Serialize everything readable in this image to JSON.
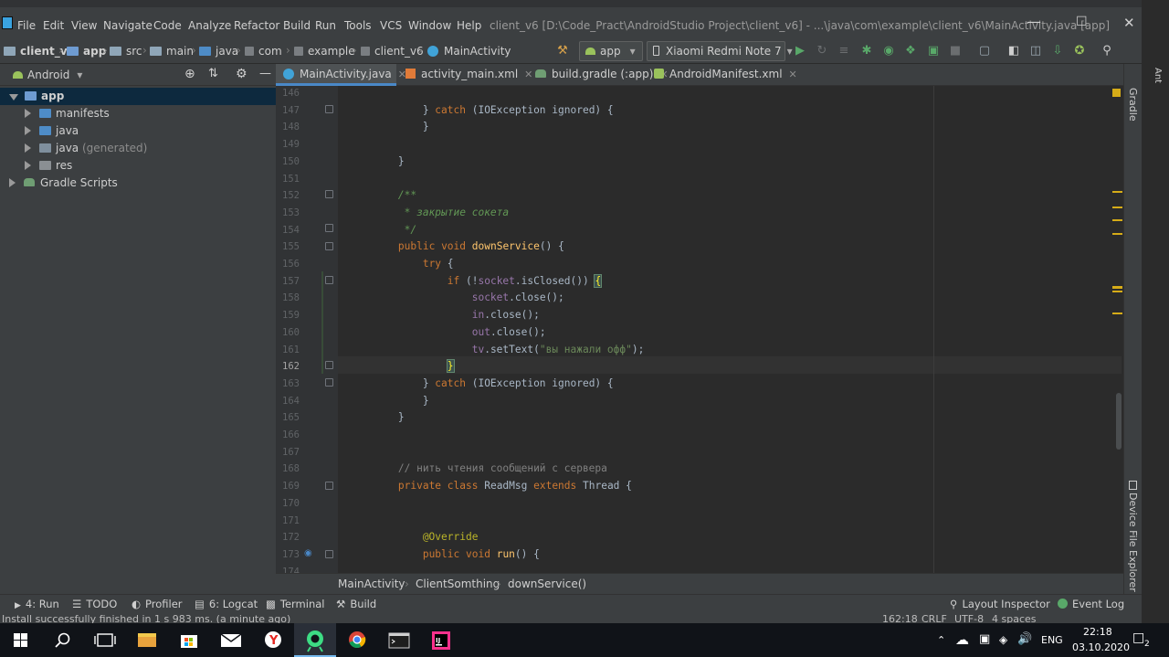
{
  "menu": {
    "items": [
      "File",
      "Edit",
      "View",
      "Navigate",
      "Code",
      "Analyze",
      "Refactor",
      "Build",
      "Run",
      "Tools",
      "VCS",
      "Window",
      "Help"
    ],
    "title": "client_v6 [D:\\Code_Pract\\AndroidStudio Project\\client_v6] - ...\\java\\com\\example\\client_v6\\MainActivity.java [app]"
  },
  "navbar": {
    "crumbs": [
      "client_v6",
      "app",
      "src",
      "main",
      "java",
      "com",
      "example",
      "client_v6",
      "MainActivity"
    ],
    "config": "app",
    "device": "Xiaomi Redmi Note 7"
  },
  "project": {
    "view": "Android",
    "tree": [
      {
        "label": "app",
        "extra": "",
        "depth": 0,
        "expanded": true,
        "selected": true
      },
      {
        "label": "manifests",
        "extra": "",
        "depth": 1,
        "expanded": false,
        "selected": false
      },
      {
        "label": "java",
        "extra": "",
        "depth": 1,
        "expanded": false,
        "selected": false
      },
      {
        "label": "java",
        "extra": "(generated)",
        "depth": 1,
        "expanded": false,
        "selected": false
      },
      {
        "label": "res",
        "extra": "",
        "depth": 1,
        "expanded": false,
        "selected": false
      },
      {
        "label": "Gradle Scripts",
        "extra": "",
        "depth": 0,
        "expanded": false,
        "selected": false
      }
    ]
  },
  "tabs": [
    {
      "label": "MainActivity.java",
      "active": true
    },
    {
      "label": "activity_main.xml",
      "active": false
    },
    {
      "label": "build.gradle (:app)",
      "active": false
    },
    {
      "label": "AndroidManifest.xml",
      "active": false
    }
  ],
  "editor": {
    "current_line": 162,
    "lines": [
      {
        "n": "146",
        "t": ""
      },
      {
        "n": "147",
        "t": "            } catch (IOException ignored) {"
      },
      {
        "n": "148",
        "t": "            }"
      },
      {
        "n": "149",
        "t": ""
      },
      {
        "n": "150",
        "t": "        }"
      },
      {
        "n": "151",
        "t": ""
      },
      {
        "n": "152",
        "t": "        /**"
      },
      {
        "n": "153",
        "t": "         * закрытие сокета"
      },
      {
        "n": "154",
        "t": "         */"
      },
      {
        "n": "155",
        "t": "        public void downService() {"
      },
      {
        "n": "156",
        "t": "            try {"
      },
      {
        "n": "157",
        "t": "                if (!socket.isClosed()) {"
      },
      {
        "n": "158",
        "t": "                    socket.close();"
      },
      {
        "n": "159",
        "t": "                    in.close();"
      },
      {
        "n": "160",
        "t": "                    out.close();"
      },
      {
        "n": "161",
        "t": "                    tv.setText(\"вы нажали офф\");"
      },
      {
        "n": "162",
        "t": "                }"
      },
      {
        "n": "163",
        "t": "            } catch (IOException ignored) {"
      },
      {
        "n": "164",
        "t": "            }"
      },
      {
        "n": "165",
        "t": "        }"
      },
      {
        "n": "166",
        "t": ""
      },
      {
        "n": "167",
        "t": ""
      },
      {
        "n": "168",
        "t": "        // нить чтения сообщений с сервера"
      },
      {
        "n": "169",
        "t": "        private class ReadMsg extends Thread {"
      },
      {
        "n": "170",
        "t": ""
      },
      {
        "n": "171",
        "t": ""
      },
      {
        "n": "172",
        "t": "            @Override"
      },
      {
        "n": "173",
        "t": "            public void run() {"
      },
      {
        "n": "174",
        "t": ""
      }
    ]
  },
  "breadcrumb": [
    "MainActivity",
    "ClientSomthing",
    "downService()"
  ],
  "tool_windows": {
    "bottom_left": [
      "4: Run",
      "TODO",
      "Profiler",
      "6: Logcat",
      "Terminal",
      "Build"
    ],
    "bottom_right": [
      "Layout Inspector",
      "Event Log"
    ],
    "right": [
      "Gradle",
      "Device File Explorer"
    ],
    "right_top": "Ant"
  },
  "status": {
    "message": "Install successfully finished in 1 s 983 ms. (a minute ago)",
    "position": "162:18",
    "line_sep": "CRLF",
    "encoding": "UTF-8",
    "indent": "4 spaces"
  },
  "taskbar": {
    "language": "ENG",
    "time": "22:18",
    "date": "03.10.2020",
    "notifications": "2"
  },
  "colors": {
    "accent": "#4a88c7",
    "keyword": "#cc7832",
    "function": "#ffc66d",
    "field": "#9876aa",
    "string": "#6a8759"
  }
}
